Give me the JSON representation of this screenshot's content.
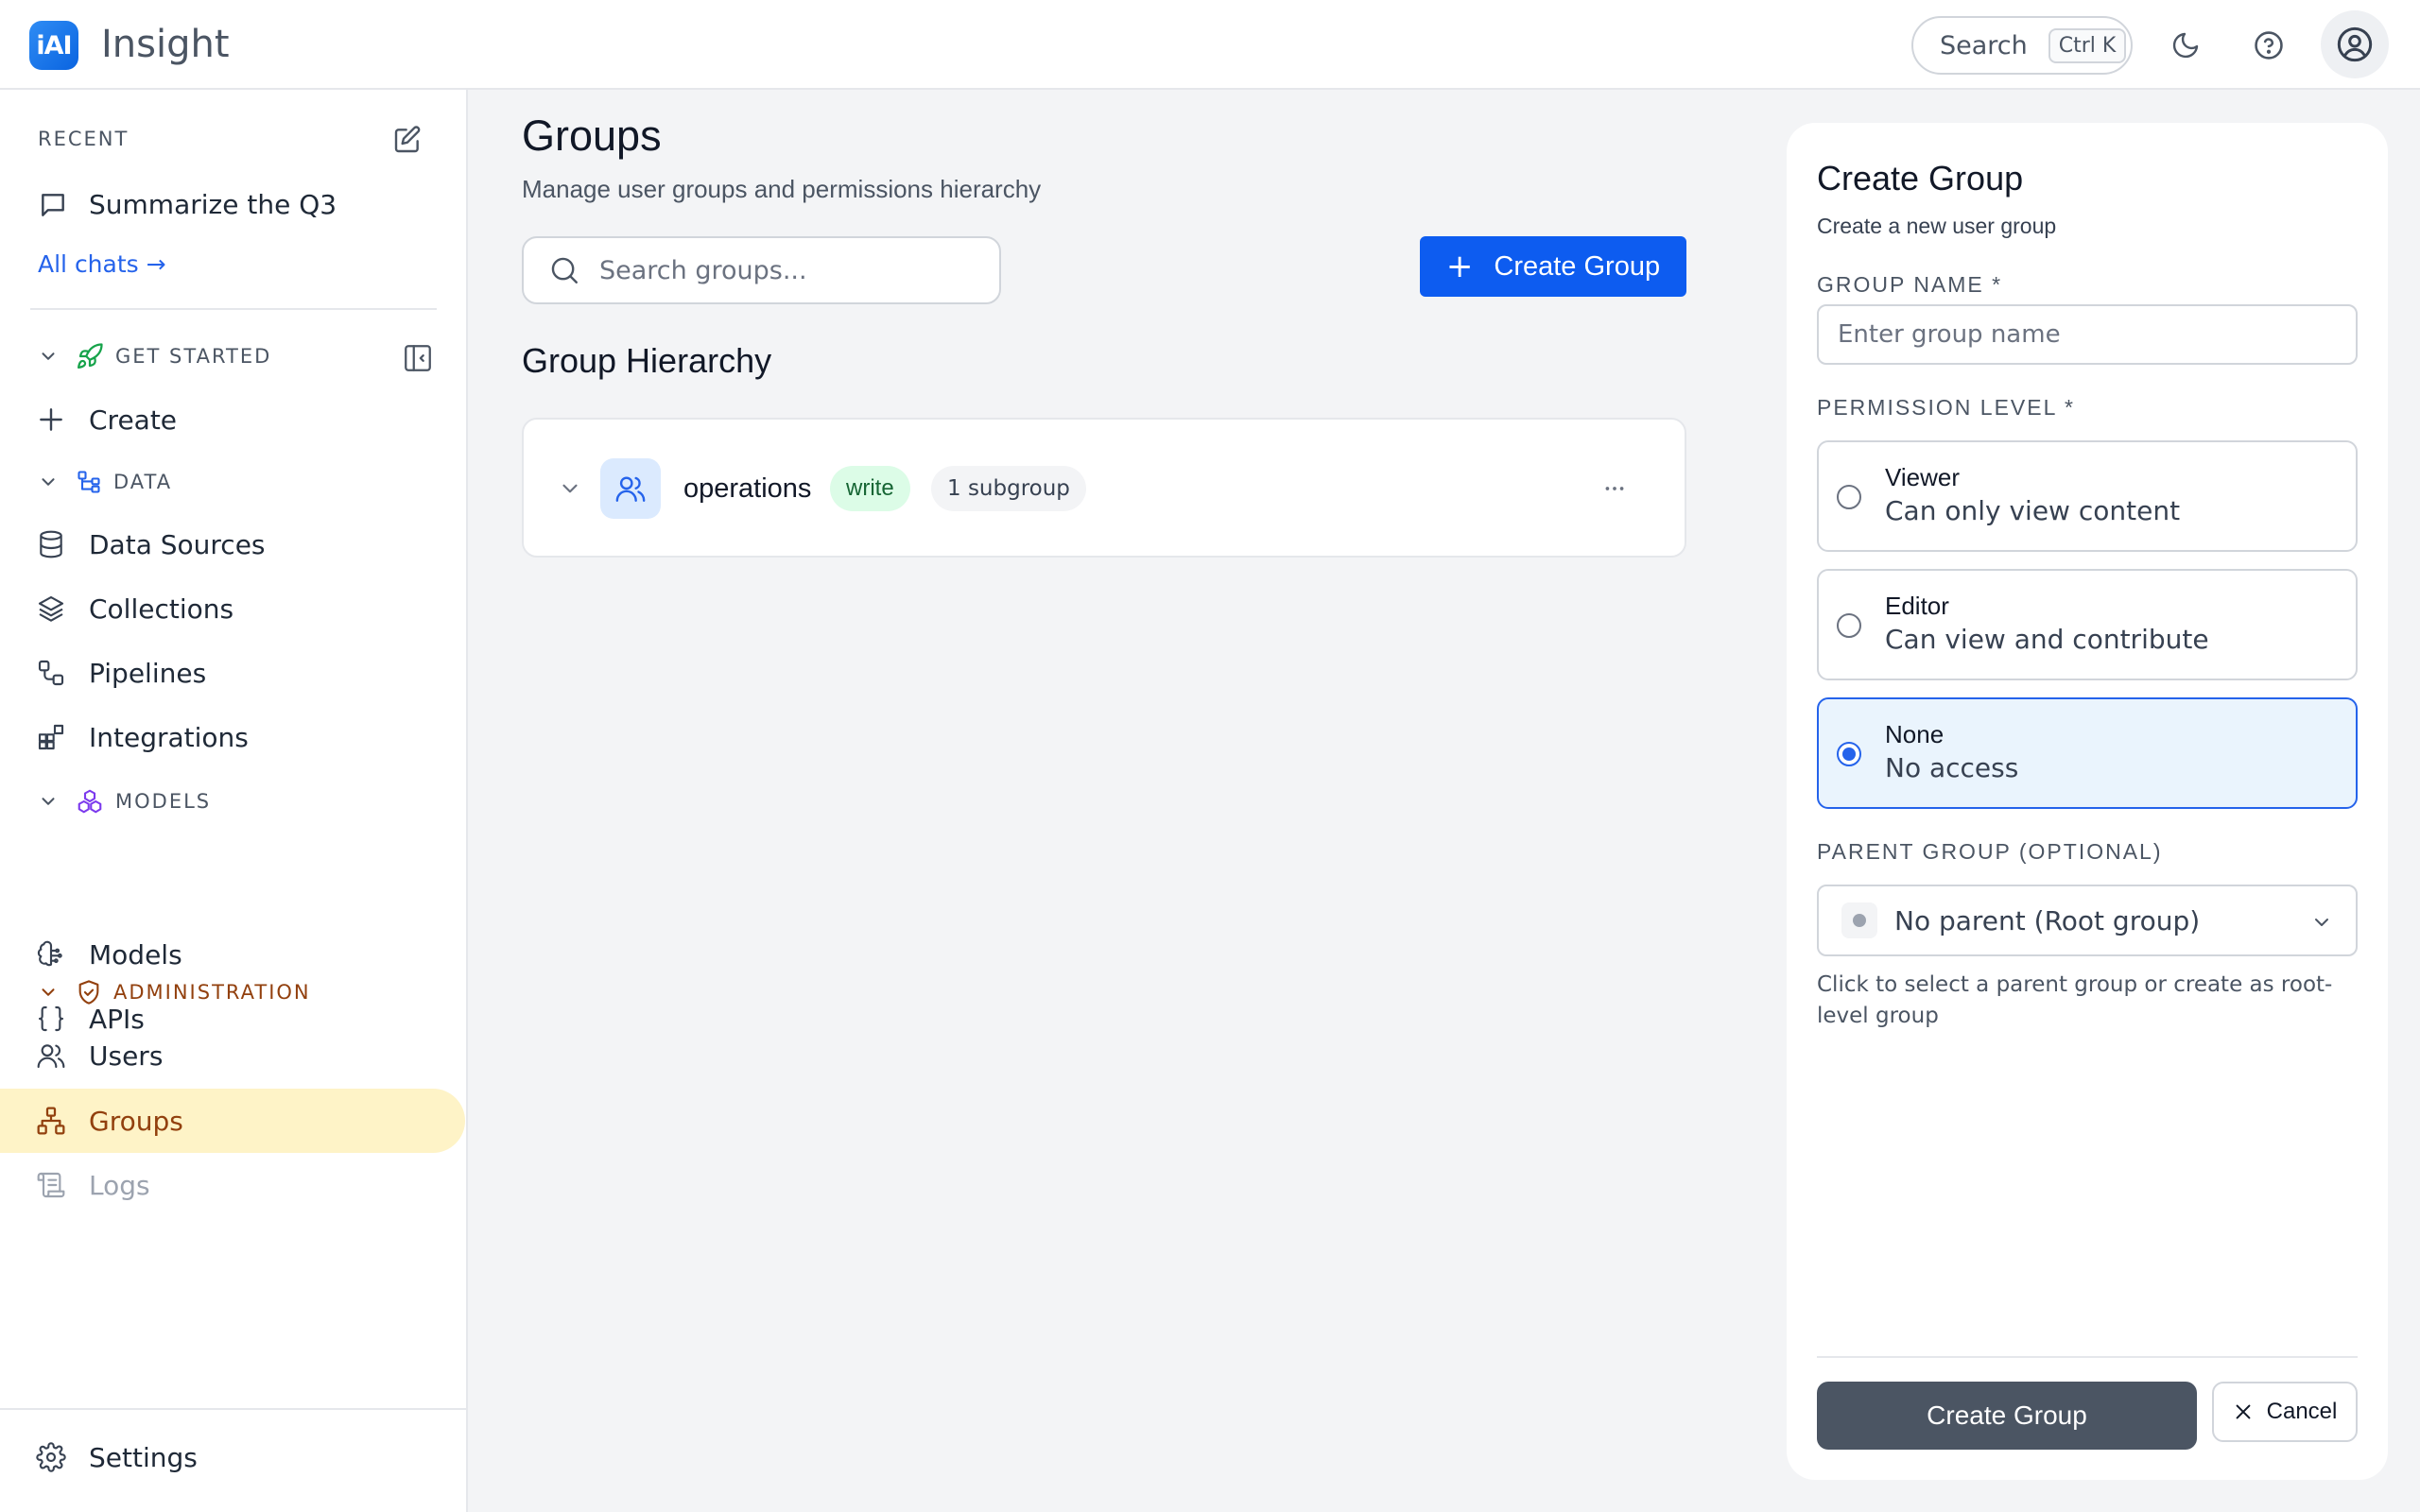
{
  "header": {
    "logo_text": "iAI",
    "app_name": "Insight",
    "search_label": "Search",
    "search_shortcut": "Ctrl K",
    "icons": [
      "moon-icon",
      "help-circle-icon",
      "user-circle-icon"
    ]
  },
  "sidebar": {
    "recent_heading": "RECENT",
    "recent_items": [
      {
        "label": "Summarize the Q3"
      }
    ],
    "all_chats": "All chats →",
    "sections": {
      "get_started": "GET STARTED",
      "data": "DATA",
      "models": "MODELS",
      "administration": "ADMINISTRATION"
    },
    "items": {
      "create": "Create",
      "data_sources": "Data Sources",
      "collections": "Collections",
      "pipelines": "Pipelines",
      "integrations": "Integrations",
      "models": "Models",
      "apis": "APIs",
      "users": "Users",
      "groups": "Groups",
      "logs": "Logs",
      "settings": "Settings"
    },
    "active_item": "Groups",
    "colors": {
      "active_bg": "#fef3c7",
      "active_text": "#92400e",
      "admin_heading": "#92400e"
    }
  },
  "main": {
    "title": "Groups",
    "subtitle": "Manage user groups and permissions hierarchy",
    "search_placeholder": "Search groups...",
    "create_button": "Create Group",
    "hierarchy_title": "Group Hierarchy",
    "groups": [
      {
        "name": "operations",
        "permission": "write",
        "subgroups": "1 subgroup"
      }
    ],
    "colors": {
      "primary": "#0d5cf0",
      "badge_write_bg": "#dcfce7",
      "badge_write_text": "#166534"
    }
  },
  "panel": {
    "title": "Create Group",
    "subtitle": "Create a new user group",
    "group_name_label": "GROUP NAME *",
    "group_name_placeholder": "Enter group name",
    "permission_label": "PERMISSION LEVEL *",
    "options": [
      {
        "title": "Viewer",
        "desc": "Can only view content",
        "selected": false
      },
      {
        "title": "Editor",
        "desc": "Can view and contribute",
        "selected": false
      },
      {
        "title": "None",
        "desc": "No access",
        "selected": true
      }
    ],
    "parent_label": "PARENT GROUP (OPTIONAL)",
    "parent_value": "No parent (Root group)",
    "parent_help": "Click to select a parent group or create as root-level group",
    "create_button": "Create Group",
    "cancel_button": "Cancel",
    "colors": {
      "selected_border": "#2563eb",
      "selected_bg": "#eaf4fd",
      "submit_bg": "#4b5563"
    }
  }
}
